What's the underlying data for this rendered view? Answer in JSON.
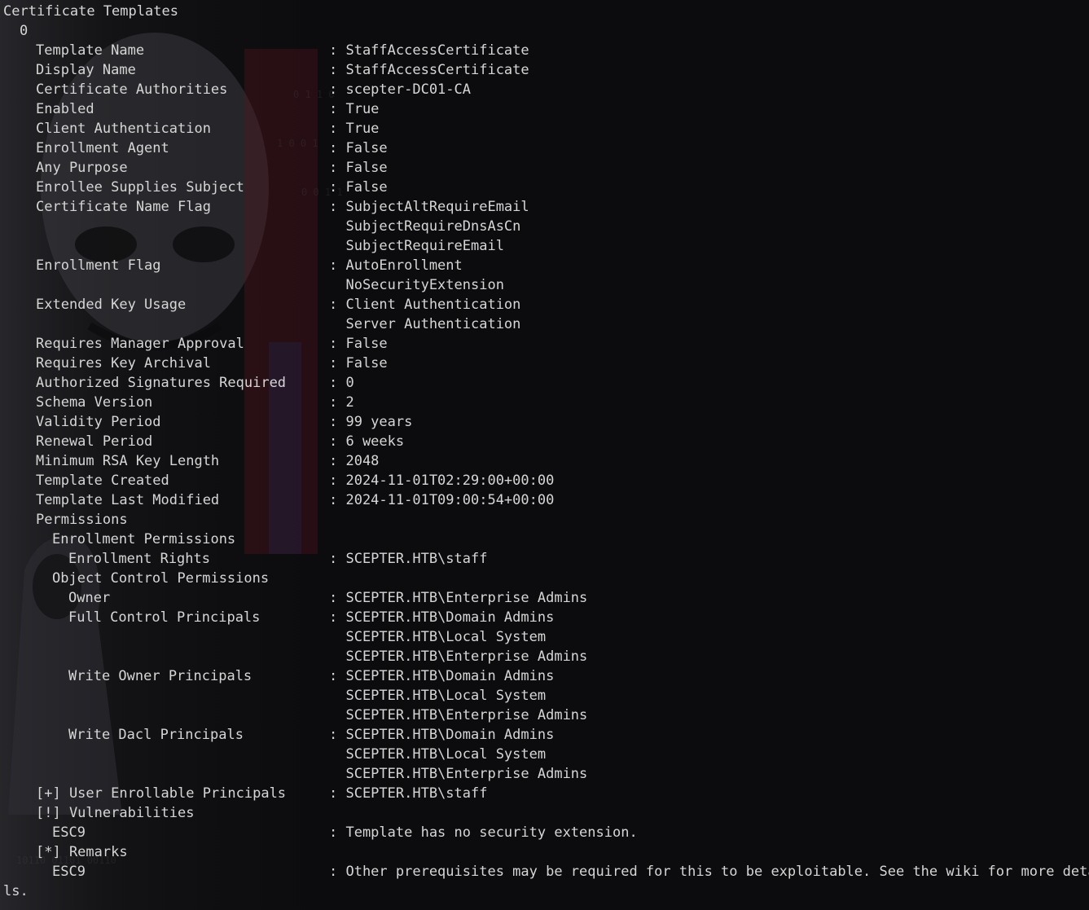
{
  "terminal": {
    "lines": [
      {
        "indent": 0,
        "label": "Certificate Templates",
        "value": ""
      },
      {
        "indent": 2,
        "label": "0",
        "value": ""
      },
      {
        "indent": 4,
        "label": "Template Name",
        "value": ": StaffAccessCertificate"
      },
      {
        "indent": 4,
        "label": "Display Name",
        "value": ": StaffAccessCertificate"
      },
      {
        "indent": 4,
        "label": "Certificate Authorities",
        "value": ": scepter-DC01-CA"
      },
      {
        "indent": 4,
        "label": "Enabled",
        "value": ": True"
      },
      {
        "indent": 4,
        "label": "Client Authentication",
        "value": ": True"
      },
      {
        "indent": 4,
        "label": "Enrollment Agent",
        "value": ": False"
      },
      {
        "indent": 4,
        "label": "Any Purpose",
        "value": ": False"
      },
      {
        "indent": 4,
        "label": "Enrollee Supplies Subject",
        "value": ": False"
      },
      {
        "indent": 4,
        "label": "Certificate Name Flag",
        "value": ": SubjectAltRequireEmail"
      },
      {
        "indent": 4,
        "label": "",
        "value": "  SubjectRequireDnsAsCn"
      },
      {
        "indent": 4,
        "label": "",
        "value": "  SubjectRequireEmail"
      },
      {
        "indent": 4,
        "label": "Enrollment Flag",
        "value": ": AutoEnrollment"
      },
      {
        "indent": 4,
        "label": "",
        "value": "  NoSecurityExtension"
      },
      {
        "indent": 4,
        "label": "Extended Key Usage",
        "value": ": Client Authentication"
      },
      {
        "indent": 4,
        "label": "",
        "value": "  Server Authentication"
      },
      {
        "indent": 4,
        "label": "Requires Manager Approval",
        "value": ": False"
      },
      {
        "indent": 4,
        "label": "Requires Key Archival",
        "value": ": False"
      },
      {
        "indent": 4,
        "label": "Authorized Signatures Required",
        "value": ": 0"
      },
      {
        "indent": 4,
        "label": "Schema Version",
        "value": ": 2"
      },
      {
        "indent": 4,
        "label": "Validity Period",
        "value": ": 99 years"
      },
      {
        "indent": 4,
        "label": "Renewal Period",
        "value": ": 6 weeks"
      },
      {
        "indent": 4,
        "label": "Minimum RSA Key Length",
        "value": ": 2048"
      },
      {
        "indent": 4,
        "label": "Template Created",
        "value": ": 2024-11-01T02:29:00+00:00"
      },
      {
        "indent": 4,
        "label": "Template Last Modified",
        "value": ": 2024-11-01T09:00:54+00:00"
      },
      {
        "indent": 4,
        "label": "Permissions",
        "value": ""
      },
      {
        "indent": 6,
        "label": "Enrollment Permissions",
        "value": ""
      },
      {
        "indent": 8,
        "label": "Enrollment Rights",
        "value": ": SCEPTER.HTB\\staff"
      },
      {
        "indent": 6,
        "label": "Object Control Permissions",
        "value": ""
      },
      {
        "indent": 8,
        "label": "Owner",
        "value": ": SCEPTER.HTB\\Enterprise Admins"
      },
      {
        "indent": 8,
        "label": "Full Control Principals",
        "value": ": SCEPTER.HTB\\Domain Admins"
      },
      {
        "indent": 8,
        "label": "",
        "value": "  SCEPTER.HTB\\Local System"
      },
      {
        "indent": 8,
        "label": "",
        "value": "  SCEPTER.HTB\\Enterprise Admins"
      },
      {
        "indent": 8,
        "label": "Write Owner Principals",
        "value": ": SCEPTER.HTB\\Domain Admins"
      },
      {
        "indent": 8,
        "label": "",
        "value": "  SCEPTER.HTB\\Local System"
      },
      {
        "indent": 8,
        "label": "",
        "value": "  SCEPTER.HTB\\Enterprise Admins"
      },
      {
        "indent": 8,
        "label": "Write Dacl Principals",
        "value": ": SCEPTER.HTB\\Domain Admins"
      },
      {
        "indent": 8,
        "label": "",
        "value": "  SCEPTER.HTB\\Local System"
      },
      {
        "indent": 8,
        "label": "",
        "value": "  SCEPTER.HTB\\Enterprise Admins"
      },
      {
        "indent": 4,
        "label": "[+] User Enrollable Principals",
        "value": ": SCEPTER.HTB\\staff"
      },
      {
        "indent": 4,
        "label": "[!] Vulnerabilities",
        "value": ""
      },
      {
        "indent": 6,
        "label": "ESC9",
        "value": ": Template has no security extension."
      },
      {
        "indent": 4,
        "label": "[*] Remarks",
        "value": ""
      },
      {
        "indent": 6,
        "label": "ESC9",
        "value": ": Other prerequisites may be required for this to be exploitable. See the wiki for more detai"
      },
      {
        "indent": 0,
        "label": "ls.",
        "value": ""
      }
    ]
  },
  "theme": {
    "background": "#0c0c0e",
    "foreground": "#d6d6d6"
  }
}
